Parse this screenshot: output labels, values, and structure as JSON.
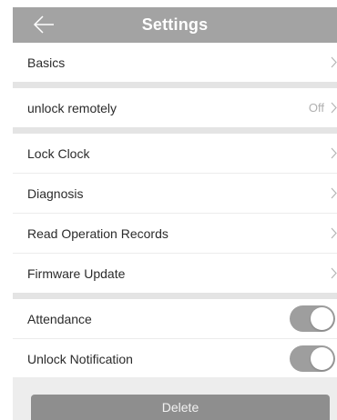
{
  "header": {
    "title": "Settings",
    "back_icon": "arrow-left-icon"
  },
  "rows": {
    "basics": "Basics",
    "unlock_remotely": "unlock remotely",
    "unlock_remotely_value": "Off",
    "lock_clock": "Lock Clock",
    "diagnosis": "Diagnosis",
    "read_operation_records": "Read Operation Records",
    "firmware_update": "Firmware Update",
    "attendance": "Attendance",
    "unlock_notification": "Unlock Notification"
  },
  "toggles": {
    "attendance_on": true,
    "unlock_notification_on": true
  },
  "footer": {
    "delete_label": "Delete"
  },
  "colors": {
    "header_bg": "#a3a3a3",
    "toggle_on": "#9e9e9e",
    "delete_bg": "#8e8e8e"
  }
}
